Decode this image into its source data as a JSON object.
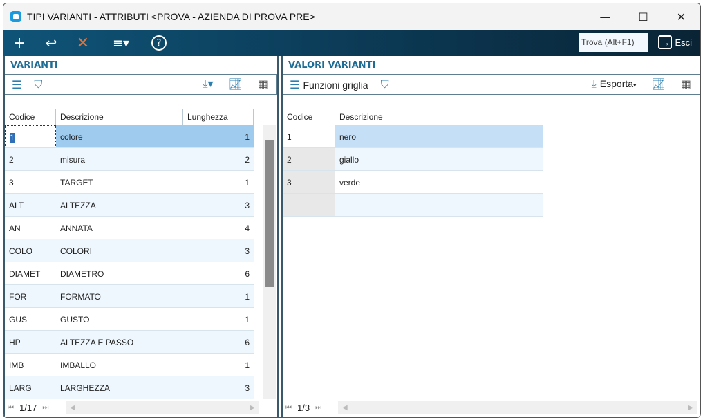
{
  "window": {
    "title": "TIPI VARIANTI - ATTRIBUTI <PROVA - AZIENDA DI PROVA PRE>"
  },
  "toolbar": {
    "find_placeholder": "Trova (Alt+F1)",
    "exit_label": "Esci"
  },
  "left": {
    "title": "VARIANTI",
    "columns": [
      "Codice",
      "Descrizione",
      "Lunghezza"
    ],
    "rows": [
      [
        "1",
        "colore",
        "1"
      ],
      [
        "2",
        "misura",
        "2"
      ],
      [
        "3",
        "TARGET",
        "1"
      ],
      [
        "ALT",
        "ALTEZZA",
        "3"
      ],
      [
        "AN",
        "ANNATA",
        "4"
      ],
      [
        "COLO",
        "COLORI",
        "3"
      ],
      [
        "DIAMET",
        "DIAMETRO",
        "6"
      ],
      [
        "FOR",
        "FORMATO",
        "1"
      ],
      [
        "GUS",
        "GUSTO",
        "1"
      ],
      [
        "HP",
        "ALTEZZA E PASSO",
        "6"
      ],
      [
        "IMB",
        "IMBALLO",
        "1"
      ],
      [
        "LARG",
        "LARGHEZZA",
        "3"
      ]
    ],
    "pager": "1/17"
  },
  "right": {
    "title": "VALORI VARIANTI",
    "grid_functions": "Funzioni griglia",
    "export": "Esporta",
    "columns": [
      "Codice",
      "Descrizione"
    ],
    "rows": [
      [
        "1",
        "nero"
      ],
      [
        "2",
        "giallo"
      ],
      [
        "3",
        "verde"
      ],
      [
        "",
        ""
      ]
    ],
    "pager": "1/3"
  }
}
